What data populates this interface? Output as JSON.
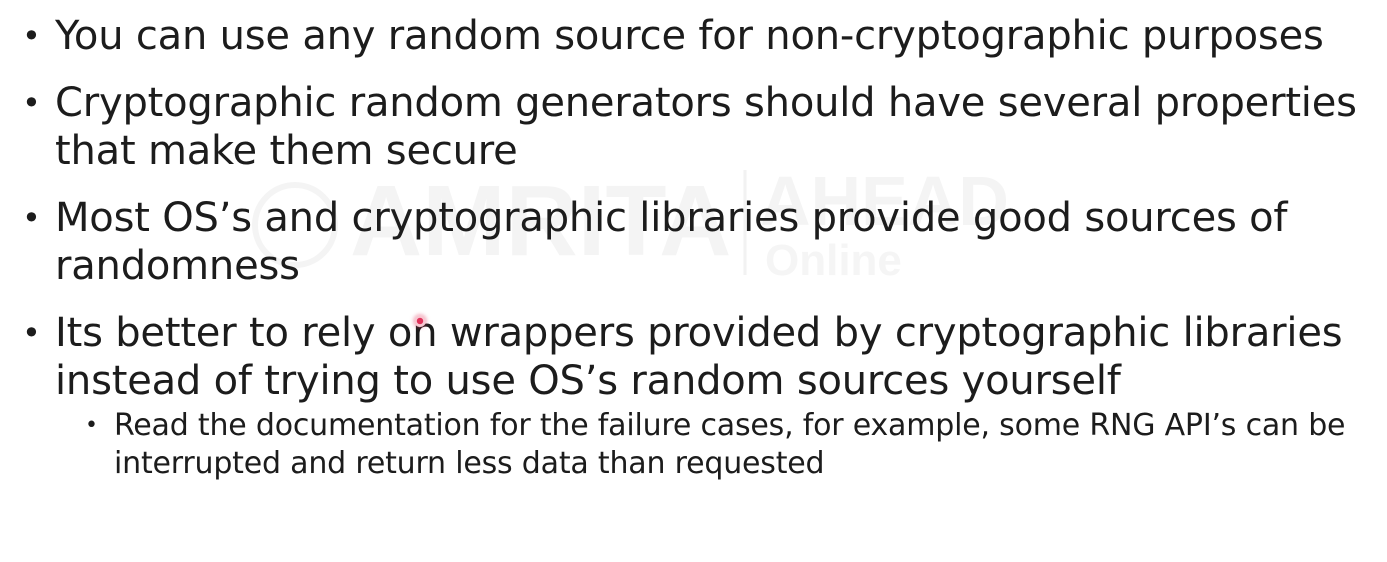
{
  "bullets": [
    {
      "text": "You can use any random source for non-cryptographic purposes"
    },
    {
      "text": "Cryptographic random generators should have several properties that make them secure"
    },
    {
      "text": "Most OS’s and cryptographic libraries provide good sources of randomness"
    },
    {
      "text": "Its better to rely on wrappers provided by cryptographic libraries instead of trying to use OS’s random sources yourself",
      "sub": [
        {
          "text": "Read the documentation for the failure cases, for example, some RNG API’s can be interrupted and return less data than requested"
        }
      ]
    }
  ],
  "watermark": {
    "logo_text": "AMRITA",
    "logo_text_2": "AHEAD",
    "logo_text_3": "Online"
  },
  "colors": {
    "text": "#1c1c1c",
    "background": "#ffffff",
    "pointer": "#e0325a"
  }
}
